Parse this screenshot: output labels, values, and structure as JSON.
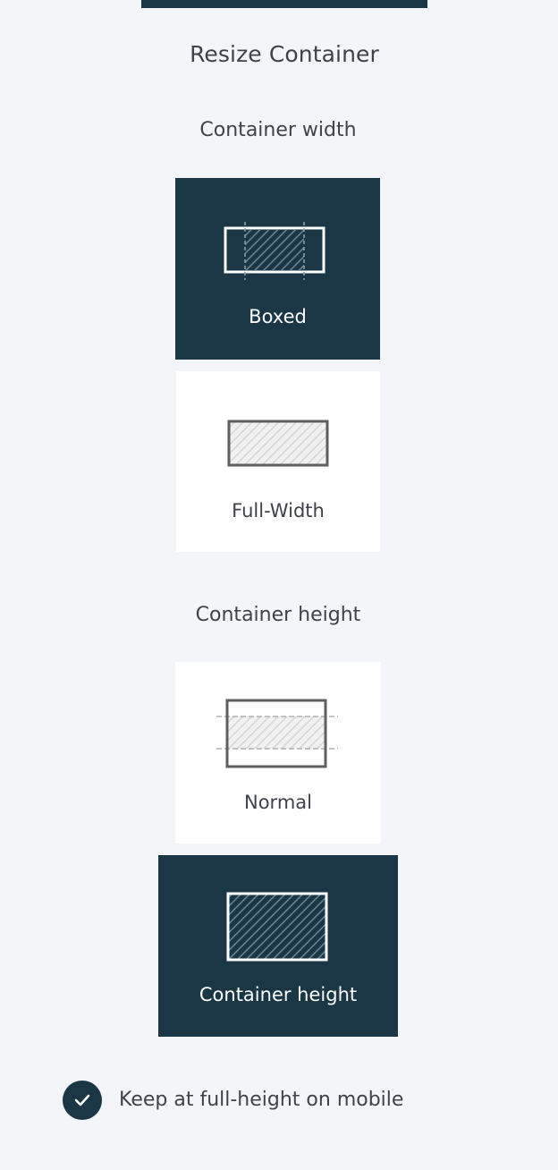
{
  "panel": {
    "title": "Resize Container"
  },
  "width_section": {
    "label": "Container width",
    "options": [
      {
        "label": "Boxed",
        "selected": true,
        "icon": "boxed-width-icon"
      },
      {
        "label": "Full-Width",
        "selected": false,
        "icon": "full-width-icon"
      }
    ]
  },
  "height_section": {
    "label": "Container height",
    "options": [
      {
        "label": "Normal",
        "selected": false,
        "icon": "normal-height-icon"
      },
      {
        "label": "Container height",
        "selected": true,
        "icon": "container-height-icon"
      }
    ]
  },
  "mobile_option": {
    "label": "Keep at full-height on mobile",
    "checked": true,
    "icon": "check-icon"
  },
  "colors": {
    "accent": "#1b3644",
    "background": "#f3f5f9",
    "card": "#ffffff",
    "text": "#3f4248"
  }
}
